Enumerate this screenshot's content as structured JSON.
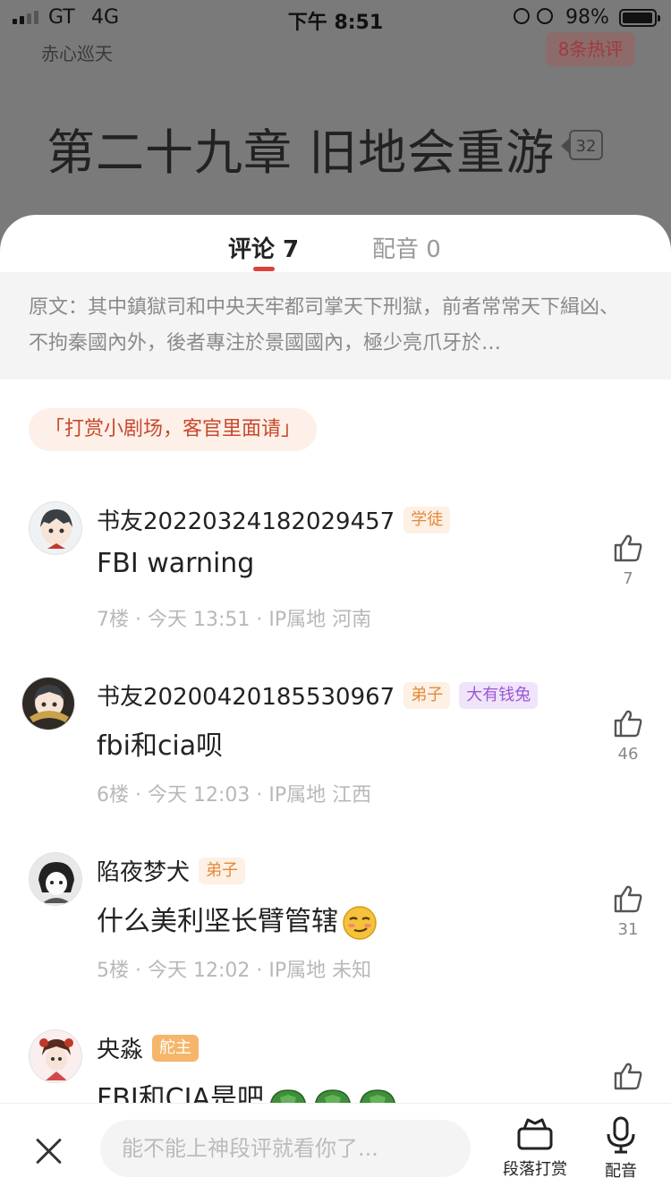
{
  "status_bar": {
    "carrier": "GT",
    "network": "4G",
    "time": "下午 8:51",
    "battery_percent": "98%",
    "battery_level": 0.98
  },
  "background": {
    "author": "赤心巡天",
    "hot_comments": "8条热评",
    "chapter_title": "第二十九章 旧地会重游",
    "paragraph_comment_count": "32"
  },
  "tabs": {
    "comments": "评论 7",
    "dubbing": "配音 0"
  },
  "quote": {
    "text": "原文：其中鎮獄司和中央天牢都司掌天下刑獄，前者常常天下緝凶、不拘秦國內外，後者專注於景國國內，極少亮爪牙於…"
  },
  "promo": {
    "label": "「打赏小剧场，客官里面请」"
  },
  "comments": [
    {
      "user": "书友20220324182029457",
      "badges": [
        "学徒"
      ],
      "text": "FBI warning",
      "meta": "7楼 · 今天 13:51 · IP属地 河南",
      "likes": "7"
    },
    {
      "user": "书友20200420185530967",
      "badges": [
        "弟子",
        "大有钱兔"
      ],
      "text": "fbi和cia呗",
      "meta": "6楼 · 今天 12:03 · IP属地 江西",
      "likes": "46"
    },
    {
      "user": "陷夜梦犬",
      "badges": [
        "弟子"
      ],
      "text": "什么美利坚长臂管辖",
      "meta": "5楼 · 今天 12:02 · IP属地 未知",
      "likes": "31"
    },
    {
      "user": "央淼",
      "badges": [
        "舵主"
      ],
      "text": "FBI和CIA是吧",
      "meta": "",
      "likes": ""
    }
  ],
  "bottom_bar": {
    "input_placeholder": "能不能上神段评就看你了...",
    "reward_label": "段落打赏",
    "dub_label": "配音"
  },
  "icons": [
    "signal-icon",
    "alarm-icon",
    "rotation-lock-icon",
    "battery-icon",
    "thumbs-up-icon",
    "close-icon",
    "reward-icon",
    "microphone-icon",
    "smirk-emoji-icon",
    "turtle-shell-emoji-icon"
  ],
  "colors": {
    "accent": "#e0403a",
    "promo_text": "#c8482c",
    "promo_bg": "#fdf0e8",
    "badge_orange": "#e28a3a",
    "badge_purple": "#9b57d4"
  }
}
